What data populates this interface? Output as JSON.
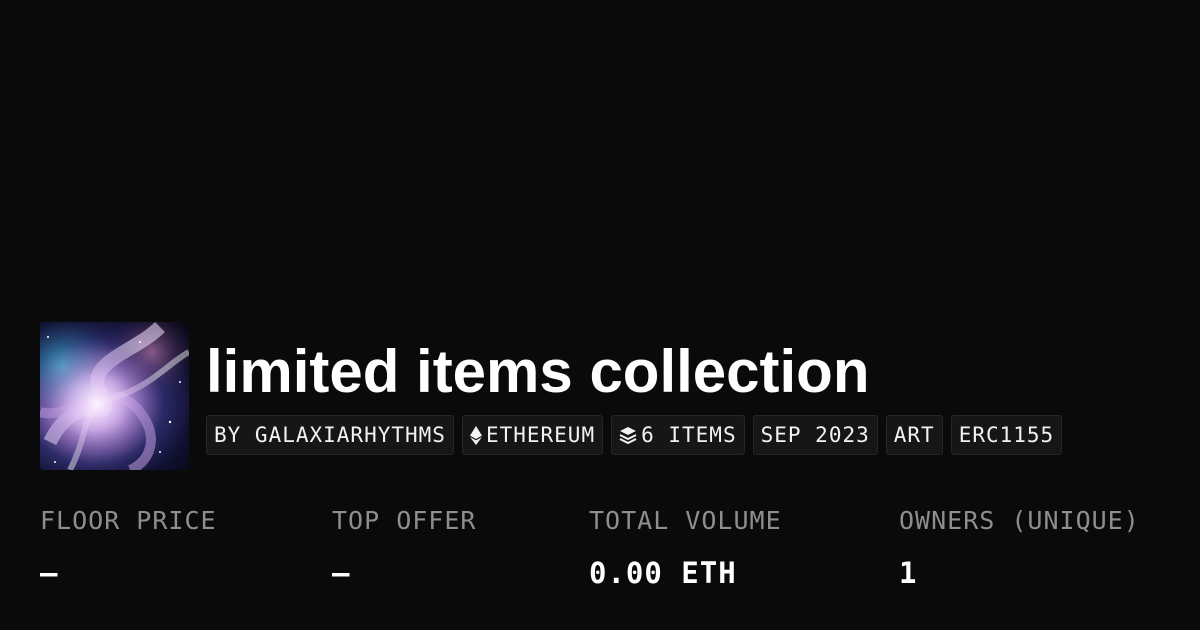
{
  "collection": {
    "title": "limited items collection",
    "badges": {
      "creator": "BY GALAXIARHYTHMS",
      "chain": "ETHEREUM",
      "items": "6 ITEMS",
      "date": "SEP 2023",
      "category": "ART",
      "standard": "ERC1155"
    },
    "badge_icons": {
      "chain": "ethereum-icon",
      "items": "layers-icon"
    }
  },
  "stats": {
    "floor_price": {
      "label": "FLOOR PRICE",
      "value": "–"
    },
    "top_offer": {
      "label": "TOP OFFER",
      "value": "–"
    },
    "total_volume": {
      "label": "TOTAL VOLUME",
      "value": "0.00 ETH"
    },
    "owners": {
      "label": "OWNERS (UNIQUE)",
      "value": "1"
    }
  },
  "colors": {
    "background": "#0a0a0a",
    "text": "#ffffff",
    "muted_label": "#8e8e8e",
    "badge_background": "#161616"
  }
}
